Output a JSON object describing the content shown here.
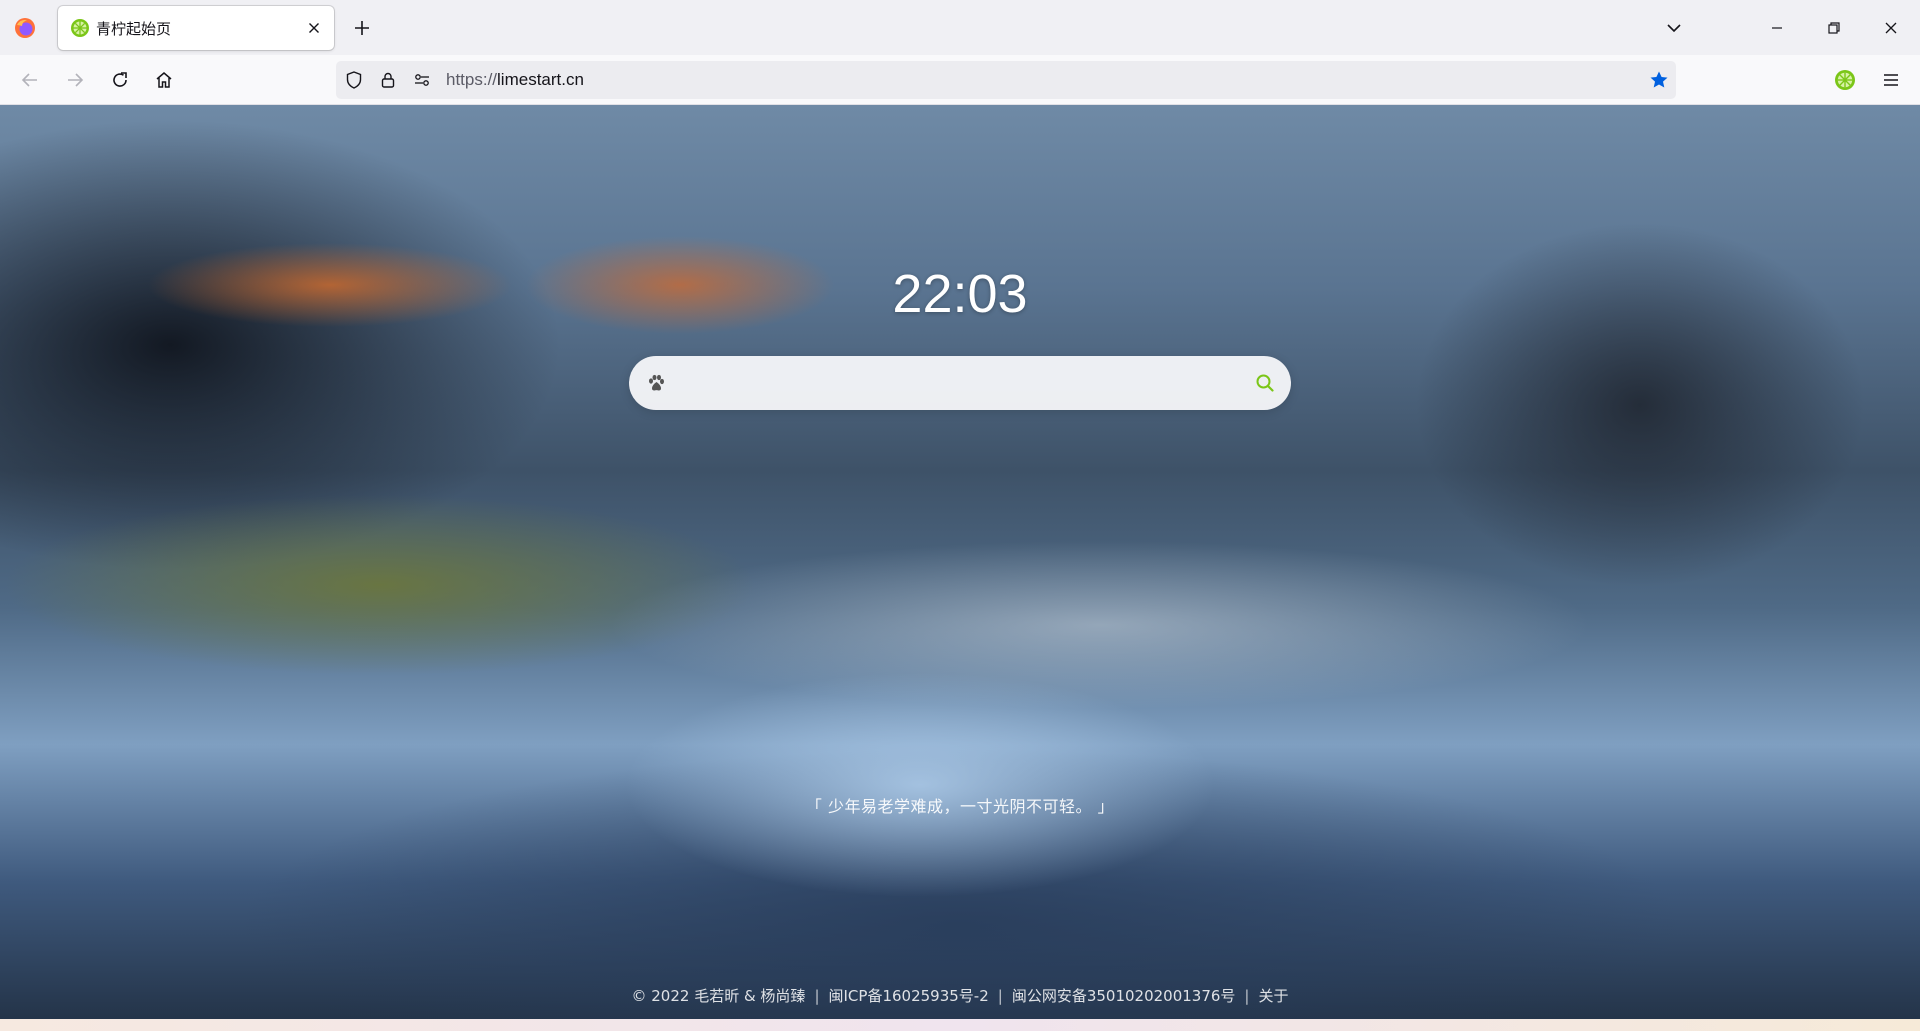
{
  "browser": {
    "tab": {
      "title": "青柠起始页"
    },
    "url": {
      "protocol": "https://",
      "host": "limestart.cn"
    },
    "icons": {
      "browser_logo": "firefox-logo-icon",
      "tab_close": "close-icon",
      "new_tab": "plus-icon",
      "tabs_list": "chevron-down-icon",
      "window_controls": [
        "minimize-icon",
        "restore-icon",
        "close-icon"
      ],
      "nav": [
        "back-arrow-icon",
        "forward-arrow-icon",
        "reload-icon",
        "home-icon"
      ],
      "url_bar": [
        "shield-icon",
        "lock-icon",
        "permissions-icon",
        "star-icon"
      ],
      "toolbar": [
        "lime-extension-icon",
        "hamburger-menu-icon"
      ]
    },
    "colors": {
      "bookmark_star": "#0060df",
      "lime_green": "#7bc618"
    }
  },
  "page": {
    "clock": "22:03",
    "search": {
      "placeholder": "",
      "value": "",
      "engine_icon": "baidu-paw-icon",
      "submit_icon": "search-icon",
      "submit_color": "#7bc618"
    },
    "quote": "「 少年易老学难成，一寸光阴不可轻。 」",
    "footer": {
      "copyright": "© 2022 毛若昕 & 杨尚臻",
      "separator": "|",
      "icp": "闽ICP备16025935号-2",
      "police": "闽公网安备35010202001376号",
      "about": "关于"
    }
  }
}
